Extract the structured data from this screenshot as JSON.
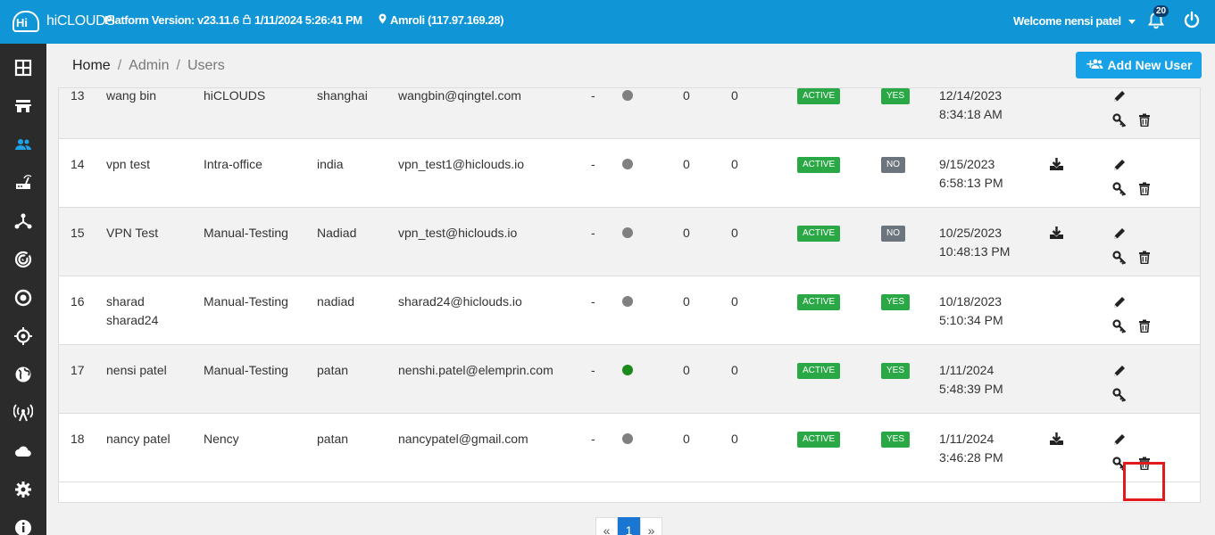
{
  "header": {
    "logo_text": "hiCLOUDS",
    "platform_version": "Platform Version: v23.11.6",
    "datetime": "1/11/2024 5:26:41 PM",
    "location": "Amroli (117.97.169.28)",
    "welcome": "Welcome nensi patel",
    "notification_count": "20"
  },
  "breadcrumb": {
    "home": "Home",
    "admin": "Admin",
    "users": "Users"
  },
  "actions": {
    "add_new_user": "Add New User"
  },
  "users": [
    {
      "id": "13",
      "name": "wang bin",
      "group": "hiCLOUDS",
      "location": "shanghai",
      "email": "wangbin@qingtel.com",
      "col": "-",
      "online": false,
      "n1": "0",
      "n2": "0",
      "status": "ACTIVE",
      "enabled": "YES",
      "date": "12/14/2023",
      "time": "8:34:18 AM",
      "download": false,
      "deletable": true
    },
    {
      "id": "14",
      "name": "vpn test",
      "group": "Intra-office",
      "location": "india",
      "email": "vpn_test1@hiclouds.io",
      "col": "-",
      "online": false,
      "n1": "0",
      "n2": "0",
      "status": "ACTIVE",
      "enabled": "NO",
      "date": "9/15/2023",
      "time": "6:58:13 PM",
      "download": true,
      "deletable": true
    },
    {
      "id": "15",
      "name": "VPN Test",
      "group": "Manual-Testing",
      "location": "Nadiad",
      "email": "vpn_test@hiclouds.io",
      "col": "-",
      "online": false,
      "n1": "0",
      "n2": "0",
      "status": "ACTIVE",
      "enabled": "NO",
      "date": "10/25/2023",
      "time": "10:48:13 PM",
      "download": true,
      "deletable": true
    },
    {
      "id": "16",
      "name": "sharad",
      "name2": "sharad24",
      "group": "Manual-Testing",
      "location": "nadiad",
      "email": "sharad24@hiclouds.io",
      "col": "-",
      "online": false,
      "n1": "0",
      "n2": "0",
      "status": "ACTIVE",
      "enabled": "YES",
      "date": "10/18/2023",
      "time": "5:10:34 PM",
      "download": false,
      "deletable": true
    },
    {
      "id": "17",
      "name": "nensi patel",
      "group": "Manual-Testing",
      "location": "patan",
      "email": "nenshi.patel@elemprin.com",
      "col": "-",
      "online": true,
      "n1": "0",
      "n2": "0",
      "status": "ACTIVE",
      "enabled": "YES",
      "date": "1/11/2024",
      "time": "5:48:39 PM",
      "download": false,
      "deletable": false
    },
    {
      "id": "18",
      "name": "nancy patel",
      "group": "Nency",
      "location": "patan",
      "email": "nancypatel@gmail.com",
      "col": "-",
      "online": false,
      "n1": "0",
      "n2": "0",
      "status": "ACTIVE",
      "enabled": "YES",
      "date": "1/11/2024",
      "time": "3:46:28 PM",
      "download": true,
      "deletable": true
    }
  ],
  "pagination": {
    "prev": "«",
    "current": "1",
    "next": "»"
  },
  "colors": {
    "topbar": "#1095d6",
    "sidebar": "#2b2b2b",
    "active_badge": "#2aa845",
    "no_badge": "#6c757d",
    "online_dot": "#1a8a1a",
    "offline_dot": "#808080",
    "highlight": "#e01b1b"
  },
  "sidebar_icons": [
    "dashboard-icon",
    "store-icon",
    "users-icon",
    "router-icon",
    "network-icon",
    "radar-icon",
    "target-icon",
    "crosshair-icon",
    "globe-icon",
    "antenna-icon",
    "cloud-icon",
    "settings-icon",
    "info-icon"
  ]
}
